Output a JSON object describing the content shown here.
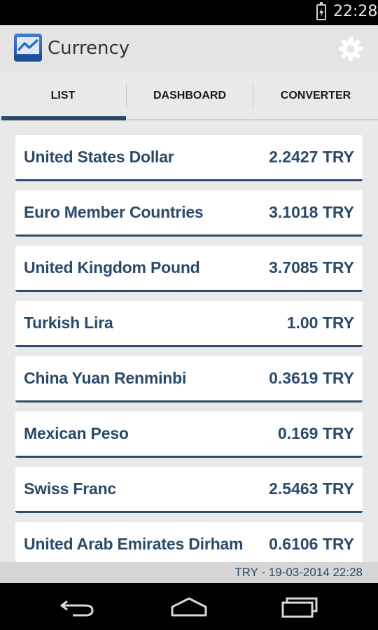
{
  "status_bar": {
    "time": "22:28"
  },
  "action_bar": {
    "title": "Currency",
    "icons": {
      "app": "chart-app-icon",
      "settings": "gear-icon"
    }
  },
  "tabs": [
    {
      "label": "LIST",
      "selected": true
    },
    {
      "label": "DASHBOARD",
      "selected": false
    },
    {
      "label": "CONVERTER",
      "selected": false
    }
  ],
  "currencies": [
    {
      "name": "United States Dollar",
      "value": "2.2427 TRY"
    },
    {
      "name": "Euro Member Countries",
      "value": "3.1018 TRY"
    },
    {
      "name": "United Kingdom Pound",
      "value": "3.7085 TRY"
    },
    {
      "name": "Turkish Lira",
      "value": "1.00 TRY"
    },
    {
      "name": "China Yuan Renminbi",
      "value": "0.3619 TRY"
    },
    {
      "name": "Mexican Peso",
      "value": "0.169 TRY"
    },
    {
      "name": "Swiss Franc",
      "value": "2.5463 TRY"
    },
    {
      "name": "United Arab Emirates Dirham",
      "value": "0.6106 TRY"
    }
  ],
  "footer": {
    "text": "TRY - 19-03-2014 22:28"
  },
  "colors": {
    "accent": "#2b4a68",
    "text": "#2a4a6a",
    "background": "#e9e9e9"
  },
  "nav_bar": {
    "icons": [
      "back-icon",
      "home-icon",
      "recent-apps-icon"
    ]
  }
}
